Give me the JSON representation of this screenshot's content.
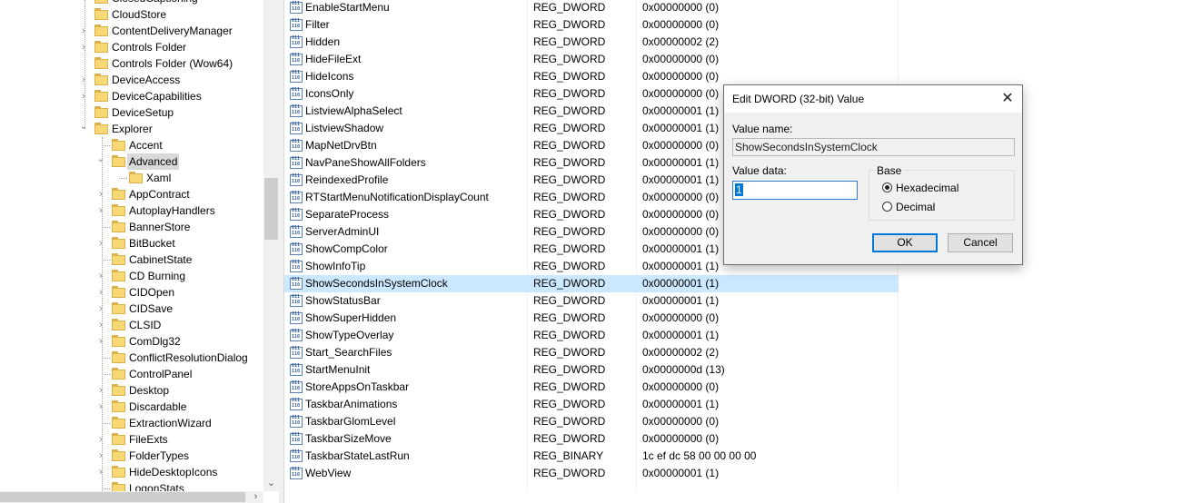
{
  "tree": {
    "items": [
      {
        "label": "ClosedCaptioning",
        "level": 0,
        "chevron": "right"
      },
      {
        "label": "CloudStore",
        "level": 0,
        "chevron": ""
      },
      {
        "label": "ContentDeliveryManager",
        "level": 0,
        "chevron": "right"
      },
      {
        "label": "Controls Folder",
        "level": 0,
        "chevron": "right"
      },
      {
        "label": "Controls Folder (Wow64)",
        "level": 0,
        "chevron": ""
      },
      {
        "label": "DeviceAccess",
        "level": 0,
        "chevron": "right"
      },
      {
        "label": "DeviceCapabilities",
        "level": 0,
        "chevron": "right"
      },
      {
        "label": "DeviceSetup",
        "level": 0,
        "chevron": ""
      },
      {
        "label": "Explorer",
        "level": 0,
        "chevron": "down"
      },
      {
        "label": "Accent",
        "level": 1,
        "chevron": ""
      },
      {
        "label": "Advanced",
        "level": 1,
        "chevron": "down",
        "selected": true
      },
      {
        "label": "Xaml",
        "level": 2,
        "chevron": ""
      },
      {
        "label": "AppContract",
        "level": 1,
        "chevron": "right"
      },
      {
        "label": "AutoplayHandlers",
        "level": 1,
        "chevron": "right"
      },
      {
        "label": "BannerStore",
        "level": 1,
        "chevron": ""
      },
      {
        "label": "BitBucket",
        "level": 1,
        "chevron": "right"
      },
      {
        "label": "CabinetState",
        "level": 1,
        "chevron": ""
      },
      {
        "label": "CD Burning",
        "level": 1,
        "chevron": "right"
      },
      {
        "label": "CIDOpen",
        "level": 1,
        "chevron": "right"
      },
      {
        "label": "CIDSave",
        "level": 1,
        "chevron": "right"
      },
      {
        "label": "CLSID",
        "level": 1,
        "chevron": "right"
      },
      {
        "label": "ComDlg32",
        "level": 1,
        "chevron": "right"
      },
      {
        "label": "ConflictResolutionDialog",
        "level": 1,
        "chevron": ""
      },
      {
        "label": "ControlPanel",
        "level": 1,
        "chevron": ""
      },
      {
        "label": "Desktop",
        "level": 1,
        "chevron": "right"
      },
      {
        "label": "Discardable",
        "level": 1,
        "chevron": "right"
      },
      {
        "label": "ExtractionWizard",
        "level": 1,
        "chevron": ""
      },
      {
        "label": "FileExts",
        "level": 1,
        "chevron": "right"
      },
      {
        "label": "FolderTypes",
        "level": 1,
        "chevron": "right"
      },
      {
        "label": "HideDesktopIcons",
        "level": 1,
        "chevron": "right"
      },
      {
        "label": "LogonStats",
        "level": 1,
        "chevron": ""
      }
    ]
  },
  "values": {
    "rows": [
      {
        "name": "EnableStartMenu",
        "type": "REG_DWORD",
        "data": "0x00000000 (0)"
      },
      {
        "name": "Filter",
        "type": "REG_DWORD",
        "data": "0x00000000 (0)"
      },
      {
        "name": "Hidden",
        "type": "REG_DWORD",
        "data": "0x00000002 (2)"
      },
      {
        "name": "HideFileExt",
        "type": "REG_DWORD",
        "data": "0x00000000 (0)"
      },
      {
        "name": "HideIcons",
        "type": "REG_DWORD",
        "data": "0x00000000 (0)"
      },
      {
        "name": "IconsOnly",
        "type": "REG_DWORD",
        "data": "0x00000000 (0)"
      },
      {
        "name": "ListviewAlphaSelect",
        "type": "REG_DWORD",
        "data": "0x00000001 (1)"
      },
      {
        "name": "ListviewShadow",
        "type": "REG_DWORD",
        "data": "0x00000001 (1)"
      },
      {
        "name": "MapNetDrvBtn",
        "type": "REG_DWORD",
        "data": "0x00000000 (0)"
      },
      {
        "name": "NavPaneShowAllFolders",
        "type": "REG_DWORD",
        "data": "0x00000001 (1)"
      },
      {
        "name": "ReindexedProfile",
        "type": "REG_DWORD",
        "data": "0x00000001 (1)"
      },
      {
        "name": "RTStartMenuNotificationDisplayCount",
        "type": "REG_DWORD",
        "data": "0x00000000 (0)"
      },
      {
        "name": "SeparateProcess",
        "type": "REG_DWORD",
        "data": "0x00000000 (0)"
      },
      {
        "name": "ServerAdminUI",
        "type": "REG_DWORD",
        "data": "0x00000000 (0)"
      },
      {
        "name": "ShowCompColor",
        "type": "REG_DWORD",
        "data": "0x00000001 (1)"
      },
      {
        "name": "ShowInfoTip",
        "type": "REG_DWORD",
        "data": "0x00000001 (1)"
      },
      {
        "name": "ShowSecondsInSystemClock",
        "type": "REG_DWORD",
        "data": "0x00000001 (1)",
        "selected": true
      },
      {
        "name": "ShowStatusBar",
        "type": "REG_DWORD",
        "data": "0x00000001 (1)"
      },
      {
        "name": "ShowSuperHidden",
        "type": "REG_DWORD",
        "data": "0x00000000 (0)"
      },
      {
        "name": "ShowTypeOverlay",
        "type": "REG_DWORD",
        "data": "0x00000001 (1)"
      },
      {
        "name": "Start_SearchFiles",
        "type": "REG_DWORD",
        "data": "0x00000002 (2)"
      },
      {
        "name": "StartMenuInit",
        "type": "REG_DWORD",
        "data": "0x0000000d (13)"
      },
      {
        "name": "StoreAppsOnTaskbar",
        "type": "REG_DWORD",
        "data": "0x00000000 (0)"
      },
      {
        "name": "TaskbarAnimations",
        "type": "REG_DWORD",
        "data": "0x00000001 (1)"
      },
      {
        "name": "TaskbarGlomLevel",
        "type": "REG_DWORD",
        "data": "0x00000000 (0)"
      },
      {
        "name": "TaskbarSizeMove",
        "type": "REG_DWORD",
        "data": "0x00000000 (0)"
      },
      {
        "name": "TaskbarStateLastRun",
        "type": "REG_BINARY",
        "data": "1c ef dc 58 00 00 00 00"
      },
      {
        "name": "WebView",
        "type": "REG_DWORD",
        "data": "0x00000001 (1)"
      }
    ]
  },
  "dialog": {
    "title": "Edit DWORD (32-bit) Value",
    "close_glyph": "✕",
    "value_name_label": "Value name:",
    "value_name": "ShowSecondsInSystemClock",
    "value_data_label": "Value data:",
    "value_data": "1",
    "base_label": "Base",
    "base_options": [
      "Hexadecimal",
      "Decimal"
    ],
    "base_selected": "Hexadecimal",
    "ok_label": "OK",
    "cancel_label": "Cancel"
  },
  "scroll": {
    "down_glyph": "⌄",
    "right_glyph": "›"
  },
  "icons": {
    "tree_folder": "folder-icon",
    "value_item": "binary-value-icon"
  },
  "colors": {
    "selection": "#cce8ff",
    "folder": "#f8d775",
    "accent": "#0078d7"
  }
}
